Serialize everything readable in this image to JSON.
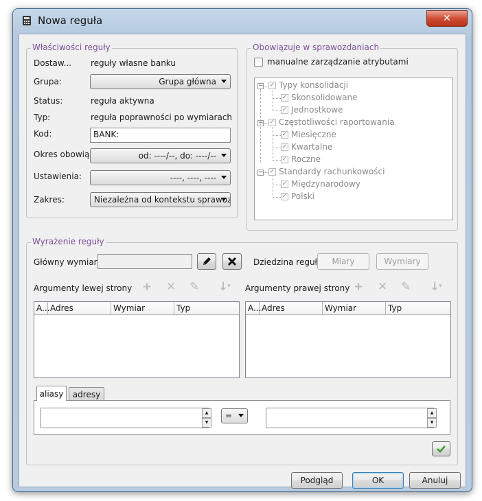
{
  "window": {
    "title": "Nowa reguła",
    "close_glyph": "✕"
  },
  "props": {
    "group_title": "Właściwości reguły",
    "fields": {
      "dostawca_label": "Dostaw...",
      "dostawca_value": "reguły własne banku",
      "grupa_label": "Grupa:",
      "grupa_value": "Grupa główna",
      "status_label": "Status:",
      "status_value": "reguła aktywna",
      "typ_label": "Typ:",
      "typ_value": "reguła poprawności po wymiarach",
      "kod_label": "Kod:",
      "kod_value": "BANK:",
      "okres_label": "Okres obowią...",
      "okres_value": "od: ----/--, do: ----/--",
      "ustawienia_label": "Ustawienia:",
      "ustawienia_value": "----, ----, ----",
      "zakres_label": "Zakres:",
      "zakres_value": "Niezależna od kontekstu sprawoz..."
    }
  },
  "reports": {
    "group_title": "Obowiązuje w sprawozdaniach",
    "manual_label": "manualne zarządzanie atrybutami",
    "tree": [
      {
        "label": "Typy konsolidacji",
        "children": [
          "Skonsolidowane",
          "Jednostkowe"
        ]
      },
      {
        "label": "Częstotliwości raportowania",
        "children": [
          "Miesięczne",
          "Kwartalne",
          "Roczne"
        ]
      },
      {
        "label": "Standardy rachunkowości",
        "children": [
          "Międzynarodowy",
          "Polski"
        ]
      }
    ],
    "check_glyph": "✓",
    "collapse_glyph": "−"
  },
  "expr": {
    "group_title": "Wyrażenie reguły",
    "main_dim_label": "Główny wymiar:",
    "domain_label": "Dziedzina reguły:",
    "measures_btn": "Miary",
    "dimensions_btn": "Wymiary",
    "left_args_label": "Argumenty lewej strony",
    "right_args_label": "Argumenty prawej strony",
    "columns": [
      "A...",
      "Adres",
      "Wymiar",
      "Typ"
    ],
    "tabs": [
      "aliasy",
      "adresy"
    ],
    "operator": "="
  },
  "buttons": {
    "preview": "Podgląd",
    "ok": "OK",
    "cancel": "Anuluj"
  }
}
